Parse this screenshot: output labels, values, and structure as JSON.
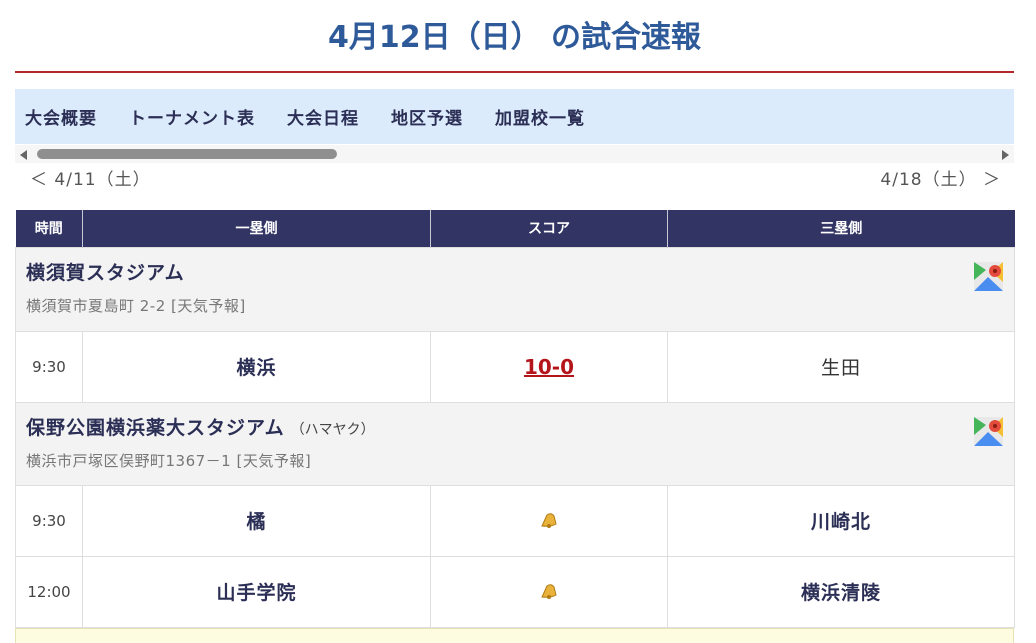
{
  "page": {
    "title": "4月12日（日） の試合速報"
  },
  "nav": {
    "items": [
      "大会概要",
      "トーナメント表",
      "大会日程",
      "地区予選",
      "加盟校一覧"
    ]
  },
  "date_nav": {
    "prev": "＜ 4/11（土）",
    "next": "4/18（土） ＞"
  },
  "table": {
    "headers": {
      "time": "時間",
      "first_base": "一塁側",
      "score": "スコア",
      "third_base": "三塁側"
    }
  },
  "venues": [
    {
      "name": "横須賀スタジアム",
      "sub": "",
      "address": "横須賀市夏島町 2-2 [天気予報]",
      "map_icon": "google-maps-icon",
      "games": [
        {
          "time": "9:30",
          "team1": "横浜",
          "score": "10-0",
          "team2": "生田"
        }
      ]
    },
    {
      "name": "保野公園横浜薬大スタジアム",
      "sub": "（ハマヤク）",
      "address": "横浜市戸塚区俣野町1367－1 [天気予報]",
      "map_icon": "google-maps-icon",
      "games": [
        {
          "time": "9:30",
          "team1": "橘",
          "score_icon": "bell-icon",
          "team2": "川崎北"
        },
        {
          "time": "12:00",
          "team1": "山手学院",
          "score_icon": "bell-icon",
          "team2": "横浜清陵"
        }
      ]
    }
  ],
  "colors": {
    "title": "#2e5a9a",
    "accent_line": "#b4272c",
    "nav_bg": "#dcebfb",
    "header_bg": "#323464",
    "score": "#b4151b",
    "team_text": "#2b2f55"
  }
}
